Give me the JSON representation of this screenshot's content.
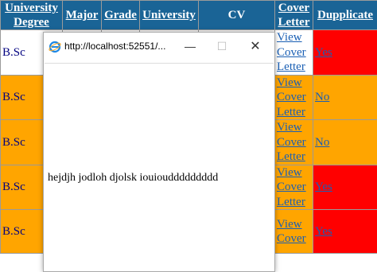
{
  "table": {
    "headers": {
      "university_degree": "University Degree",
      "major": "Major",
      "grade": "Grade",
      "university": "University",
      "cv": "CV",
      "cover_letter": "Cover Letter",
      "dupplicate": "Dupplicate"
    },
    "rows": [
      {
        "degree": "B.Sc",
        "cover": "View Cover Letter",
        "dup": "Yes"
      },
      {
        "degree": "B.Sc",
        "cover": "View Cover Letter",
        "dup": "No"
      },
      {
        "degree": "B.Sc",
        "cover": "View Cover Letter",
        "dup": "No"
      },
      {
        "degree": "B.Sc",
        "cover": "View Cover Letter",
        "dup": "Yes"
      },
      {
        "degree": "B.Sc",
        "cover": "View Cover",
        "dup": "Yes"
      }
    ]
  },
  "popup": {
    "url": "http://localhost:52551/...",
    "minimize_icon": "minimize-icon",
    "maximize_icon": "maximize-icon",
    "close_icon": "close-icon",
    "message": "hejdjh jodloh djolsk iouiouddddddddd"
  },
  "colors": {
    "header_bg": "#1a6496",
    "orange": "#ffa500",
    "red": "#ff0000",
    "link": "#1a5fb4"
  }
}
